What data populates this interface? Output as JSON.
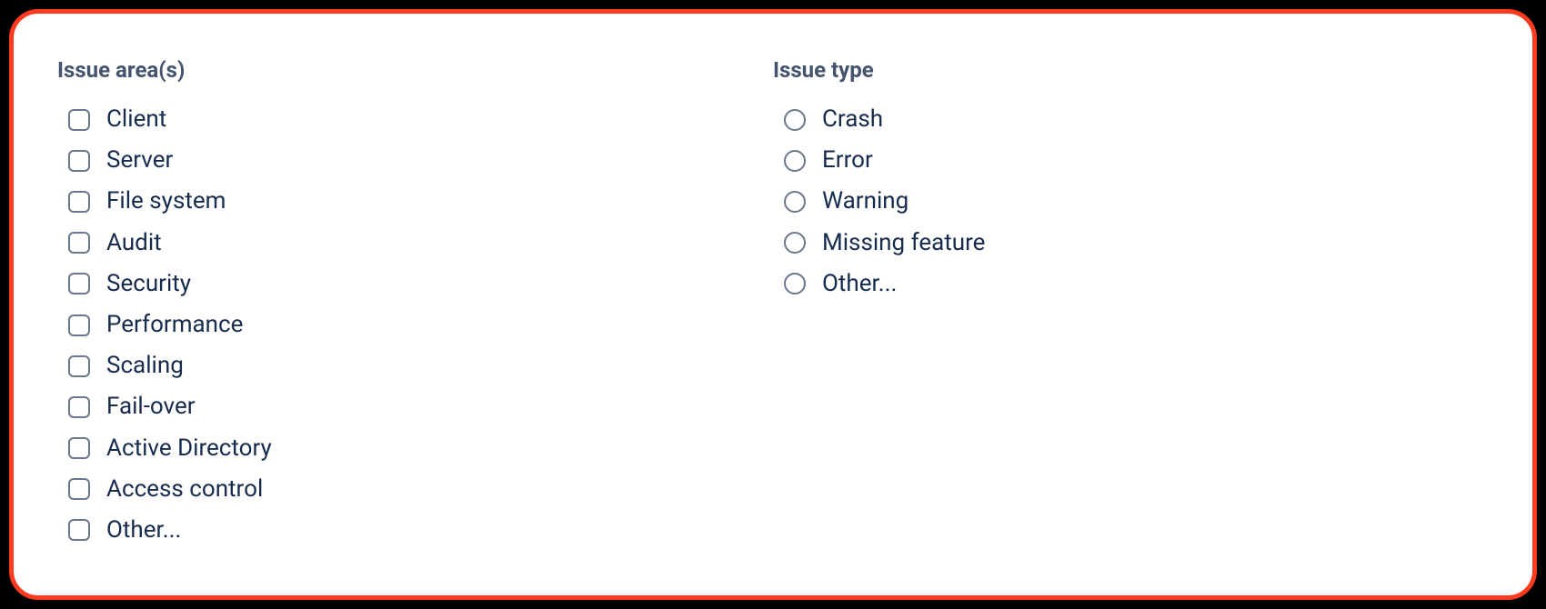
{
  "issue_area": {
    "label": "Issue area(s)",
    "options": [
      "Client",
      "Server",
      "File system",
      "Audit",
      "Security",
      "Performance",
      "Scaling",
      "Fail-over",
      "Active Directory",
      "Access control",
      "Other..."
    ]
  },
  "issue_type": {
    "label": "Issue type",
    "options": [
      "Crash",
      "Error",
      "Warning",
      "Missing feature",
      "Other..."
    ]
  }
}
